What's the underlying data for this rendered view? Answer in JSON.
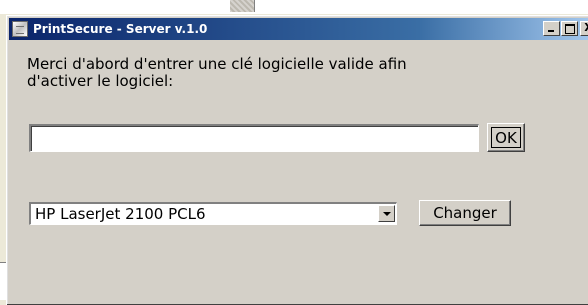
{
  "window": {
    "title": "PrintSecure - Server v.1.0",
    "icon": "app-printsecure-icon",
    "controls": {
      "minimize_icon": "minimize-icon",
      "maximize_icon": "maximize-icon",
      "close_label": "X"
    }
  },
  "main": {
    "message_line1": "Merci d'abord d'entrer une clé logicielle valide afin",
    "message_line2": "d'activer le logiciel:",
    "key_input": {
      "value": "",
      "placeholder": ""
    },
    "ok_label": "OK",
    "printer_select": {
      "selected": "HP LaserJet 2100 PCL6",
      "arrow_icon": "chevron-down-icon"
    },
    "change_label": "Changer"
  },
  "colors": {
    "titlebar_start": "#0a246a",
    "titlebar_end": "#a6caf0",
    "window_bg": "#d4d0c8"
  }
}
